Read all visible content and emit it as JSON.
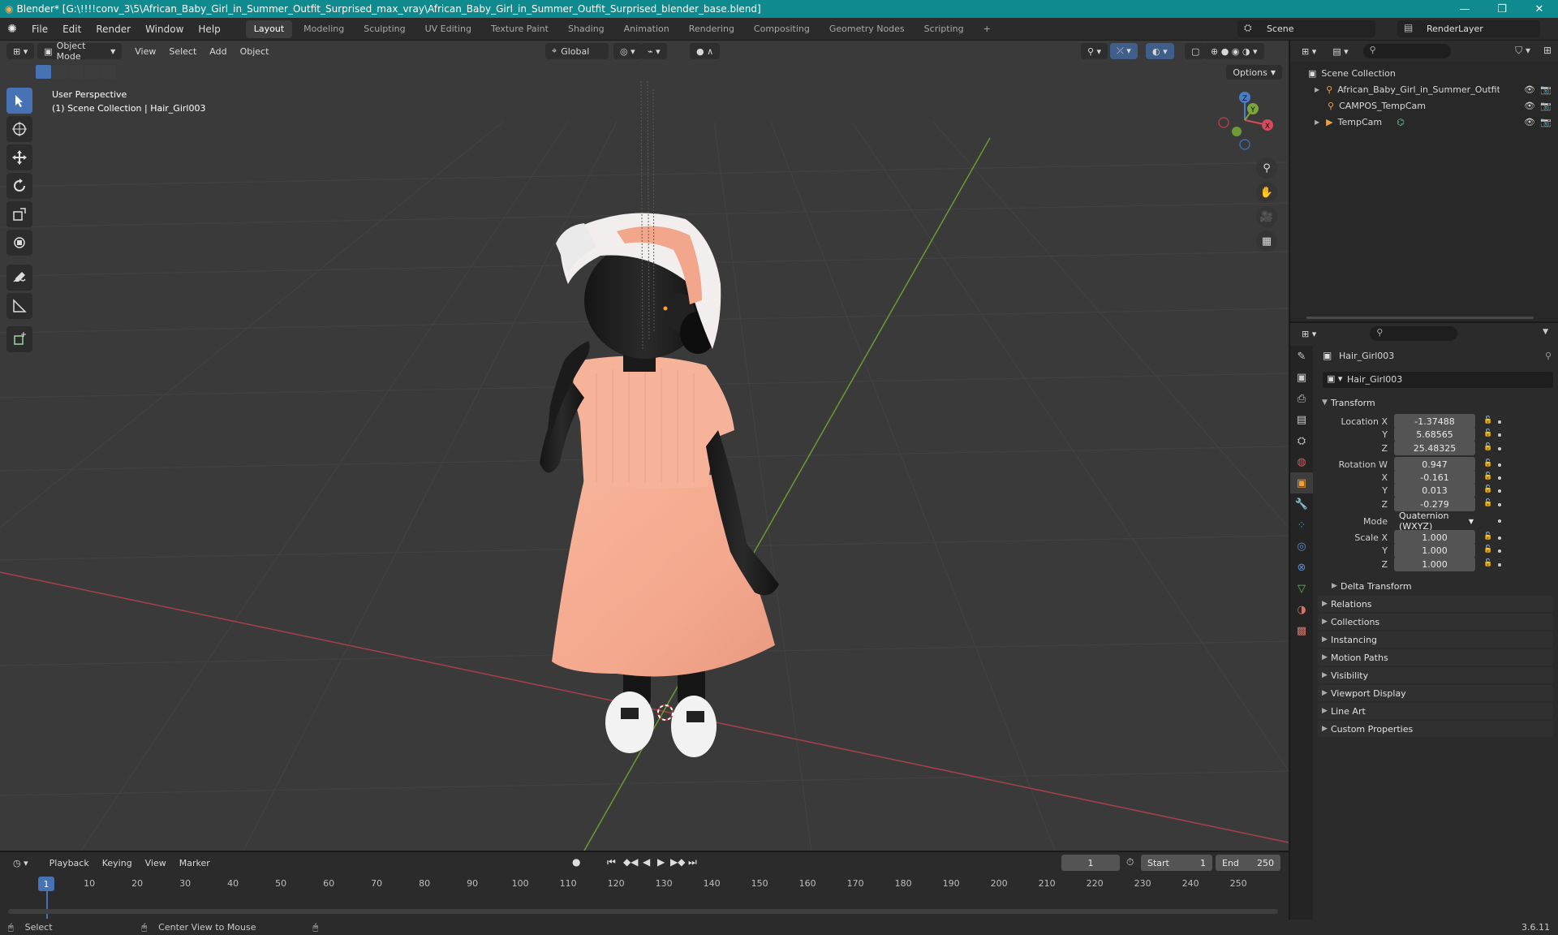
{
  "window": {
    "title": "Blender* [G:\\!!!!conv_3\\5\\African_Baby_Girl_in_Summer_Outfit_Surprised_max_vray\\African_Baby_Girl_in_Summer_Outfit_Surprised_blender_base.blend]",
    "minimize": "—",
    "maximize": "❐",
    "close": "✕"
  },
  "menu": [
    "File",
    "Edit",
    "Render",
    "Window",
    "Help"
  ],
  "workspaces": [
    "Layout",
    "Modeling",
    "Sculpting",
    "UV Editing",
    "Texture Paint",
    "Shading",
    "Animation",
    "Rendering",
    "Compositing",
    "Geometry Nodes",
    "Scripting"
  ],
  "workspace_add": "+",
  "scene": "Scene",
  "render_layer": "RenderLayer",
  "viewport": {
    "mode": "Object Mode",
    "menus": [
      "View",
      "Select",
      "Add",
      "Object"
    ],
    "orientation": "Global",
    "options": "Options",
    "perspective": "User Perspective",
    "collection_info": "(1) Scene Collection | Hair_Girl003",
    "gizmo": {
      "x": "X",
      "y": "Y",
      "z": "Z"
    }
  },
  "outliner": {
    "root": "Scene Collection",
    "items": [
      {
        "name": "African_Baby_Girl_in_Summer_Outfit_Su"
      },
      {
        "name": "CAMPOS_TempCam"
      },
      {
        "name": "TempCam"
      }
    ]
  },
  "properties": {
    "object_name": "Hair_Girl003",
    "datablock": "Hair_Girl003",
    "transform_title": "Transform",
    "location_label": "Location X",
    "location": [
      "-1.37488",
      "5.68565",
      "25.48325"
    ],
    "rotation_label": "Rotation W",
    "rotation": [
      "0.947",
      "-0.161",
      "0.013",
      "-0.279"
    ],
    "axis_labels": [
      "Y",
      "Z",
      "X",
      "Y",
      "Z",
      "Y",
      "Z"
    ],
    "mode_label": "Mode",
    "mode_value": "Quaternion (WXYZ)",
    "scale_label": "Scale X",
    "scale": [
      "1.000",
      "1.000",
      "1.000"
    ],
    "delta": "Delta Transform",
    "sections": [
      "Relations",
      "Collections",
      "Instancing",
      "Motion Paths",
      "Visibility",
      "Viewport Display",
      "Line Art",
      "Custom Properties"
    ]
  },
  "timeline": {
    "menus": [
      "Playback",
      "Keying",
      "View",
      "Marker"
    ],
    "current_frame": "1",
    "start_label": "Start",
    "start": "1",
    "end_label": "End",
    "end": "250",
    "ticks": [
      "10",
      "20",
      "30",
      "40",
      "50",
      "60",
      "70",
      "80",
      "90",
      "100",
      "110",
      "120",
      "130",
      "140",
      "150",
      "160",
      "170",
      "180",
      "190",
      "200",
      "210",
      "220",
      "230",
      "240",
      "250"
    ],
    "playhead": "1"
  },
  "status": {
    "select": "Select",
    "center": "Center View to Mouse",
    "version": "3.6.11"
  }
}
